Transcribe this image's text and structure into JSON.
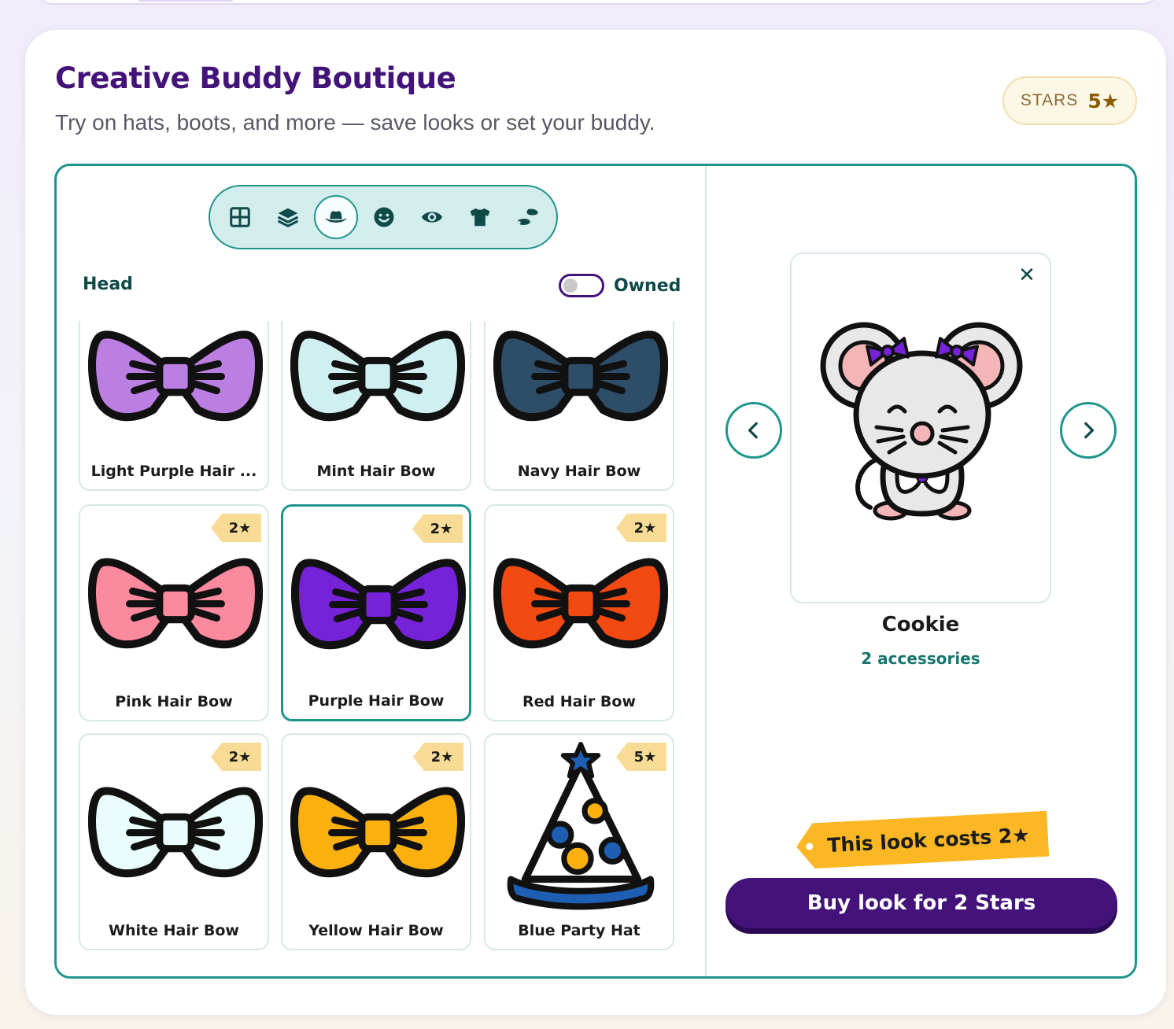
{
  "app": {
    "title": "Creative Buddy Boutique",
    "subtitle": "Try on hats, boots, and more — save looks or set your buddy.",
    "stars": {
      "label": "STARS",
      "value": "5★"
    }
  },
  "categories": [
    {
      "icon": "grid-icon",
      "active": false
    },
    {
      "icon": "layers-icon",
      "active": false
    },
    {
      "icon": "hat-icon",
      "active": true
    },
    {
      "icon": "face-icon",
      "active": false
    },
    {
      "icon": "eye-icon",
      "active": false
    },
    {
      "icon": "shirt-icon",
      "active": false
    },
    {
      "icon": "shoes-icon",
      "active": false
    }
  ],
  "shop": {
    "section_label": "Head",
    "owned_toggle": {
      "label": "Owned",
      "on": false
    },
    "items": [
      {
        "name": "Light Purple Hair ...",
        "price": null,
        "kind": "bow",
        "color": "#bb7fe3",
        "selected": false
      },
      {
        "name": "Mint Hair Bow",
        "price": null,
        "kind": "bow",
        "color": "#d0eff0",
        "selected": false
      },
      {
        "name": "Navy Hair Bow",
        "price": null,
        "kind": "bow",
        "color": "#2e4d69",
        "selected": false
      },
      {
        "name": "Pink Hair Bow",
        "price": "2★",
        "kind": "bow",
        "color": "#fc8a9e",
        "selected": false
      },
      {
        "name": "Purple Hair Bow",
        "price": "2★",
        "kind": "bow",
        "color": "#7522d8",
        "selected": true
      },
      {
        "name": "Red Hair Bow",
        "price": "2★",
        "kind": "bow",
        "color": "#f24a10",
        "selected": false
      },
      {
        "name": "White Hair Bow",
        "price": "2★",
        "kind": "bow",
        "color": "#e9fdfd",
        "selected": false
      },
      {
        "name": "Yellow Hair Bow",
        "price": "2★",
        "kind": "bow",
        "color": "#fbb00e",
        "selected": false
      },
      {
        "name": "Blue Party Hat",
        "price": "5★",
        "kind": "party-hat",
        "color": "#1e5fb4",
        "selected": false
      }
    ]
  },
  "preview": {
    "buddy_name": "Cookie",
    "accessories": "2 accessories",
    "cost_label": "This look costs 2★",
    "buy_label": "Buy look for 2 Stars"
  },
  "colors": {
    "brand_purple": "#43137a",
    "teal": "#1f958c",
    "tag_yellow": "#f8dc96",
    "cost_orange": "#fbb724"
  }
}
